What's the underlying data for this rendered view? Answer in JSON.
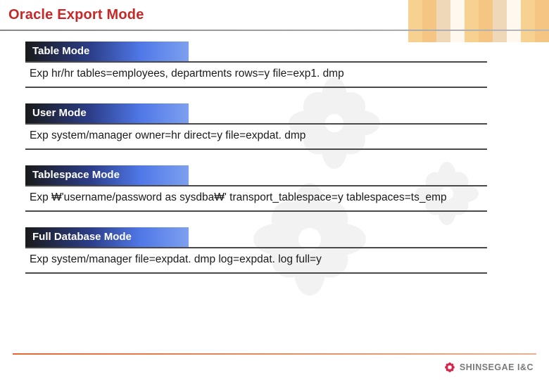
{
  "title": "Oracle Export Mode",
  "sections": [
    {
      "title": "Table Mode",
      "body": "Exp hr/hr tables=employees, departments rows=y file=exp1. dmp"
    },
    {
      "title": "User Mode",
      "body": "Exp system/manager owner=hr direct=y file=expdat. dmp"
    },
    {
      "title": "Tablespace Mode",
      "body": "Exp ₩'username/password as sysdba₩' transport_tablespace=y tablespaces=ts_emp"
    },
    {
      "title": "Full Database Mode",
      "body": "Exp system/manager file=expdat. dmp log=expdat. log full=y"
    }
  ],
  "footer": {
    "brand": "SHINSEGAE I&C"
  },
  "colors": {
    "title": "#c62828",
    "section_grad_start": "#1a1a1a",
    "section_grad_end": "#7da0f0",
    "rule": "#4a4a4a",
    "footer_rule": "#e06830",
    "logo": "#d9254b"
  }
}
